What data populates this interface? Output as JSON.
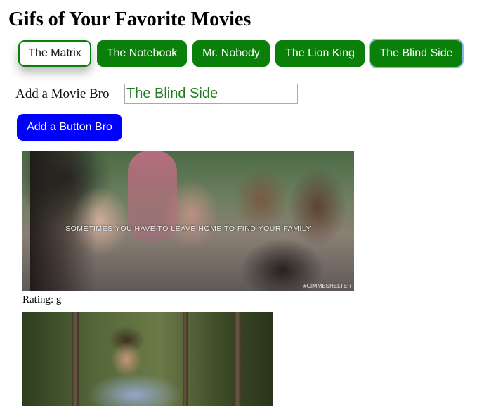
{
  "page": {
    "title": "Gifs of Your Favorite Movies"
  },
  "movie_buttons": [
    {
      "label": "The Matrix",
      "state": "selected"
    },
    {
      "label": "The Notebook",
      "state": "normal"
    },
    {
      "label": "Mr. Nobody",
      "state": "normal"
    },
    {
      "label": "The Lion King",
      "state": "normal"
    },
    {
      "label": "The Blind Side",
      "state": "focused"
    }
  ],
  "form": {
    "label": "Add a Movie Bro",
    "input_value": "The Blind Side",
    "submit_label": "Add a Button Bro"
  },
  "gifs": [
    {
      "caption": "SOMETIMES YOU HAVE TO LEAVE HOME TO FIND YOUR FAMILY",
      "watermark": "#GIMMESHELTER",
      "rating": "Rating: g"
    },
    {
      "caption": "",
      "watermark": ""
    }
  ],
  "colors": {
    "movie_button_bg": "#0a7f0a",
    "add_button_bg": "#0000ff",
    "input_text": "#1e7b1e",
    "focus_outline": "#8bb6e8"
  }
}
